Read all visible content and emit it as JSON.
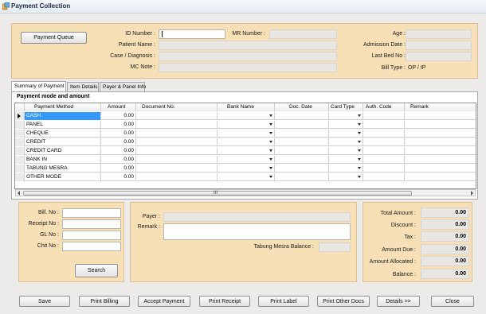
{
  "window": {
    "title": "Payment Collection",
    "icon": "app-icon"
  },
  "header": {
    "payment_queue_label": "Payment Queue",
    "id_number_label": "ID Number :",
    "id_number_value": "",
    "mr_number_label": "MR Number :",
    "mr_number_value": "",
    "age_label": "Age :",
    "age_value": "",
    "patient_name_label": "Patient Name :",
    "patient_name_value": "",
    "admission_date_label": "Admission Date :",
    "admission_date_value": "",
    "case_label": "Case / Diagnosis :",
    "case_value": "",
    "last_bed_label": "Last Bed No :",
    "last_bed_value": "",
    "mc_note_label": "MC Note :",
    "mc_note_value": "",
    "bill_type_label": "Bill Type :",
    "bill_type_value": "OP / IP"
  },
  "tabs": [
    {
      "label": "Summary of Payment",
      "active": true
    },
    {
      "label": "Item Details",
      "active": false
    },
    {
      "label": "Payer & Panel Info",
      "active": false
    }
  ],
  "payment_panel": {
    "title": "Payment mode and amount",
    "columns": [
      "Payment Method",
      "Amount",
      "Document No.",
      "Bank Name",
      "Doc. Date",
      "Card Type",
      "Auth. Code",
      "Remark"
    ],
    "rows": [
      {
        "method": "CASH",
        "amount": "0.00",
        "selected": true
      },
      {
        "method": "PANEL",
        "amount": "0.00"
      },
      {
        "method": "CHEQUE",
        "amount": "0.00"
      },
      {
        "method": "CREDIT",
        "amount": "0.00"
      },
      {
        "method": "CREDIT CARD",
        "amount": "0.00"
      },
      {
        "method": "BANK IN",
        "amount": "0.00"
      },
      {
        "method": "TABUNG MESRA",
        "amount": "0.00"
      },
      {
        "method": "OTHER MODE",
        "amount": "0.00"
      }
    ],
    "scroll_grip": "III"
  },
  "search_box": {
    "bill_no_label": "Bill. No :",
    "receipt_no_label": "Receipt No :",
    "gl_no_label": "GL No :",
    "chit_no_label": "Chit No :",
    "search_label": "Search"
  },
  "payer_box": {
    "payer_label": "Payer :",
    "payer_value": "",
    "remark_label": "Remark :",
    "remark_value": "",
    "tabung_label": "Tabung Mesra Balance :",
    "tabung_value": ""
  },
  "totals": {
    "total_amount_label": "Total Amount :",
    "total_amount": "0.00",
    "discount_label": "Discount :",
    "discount": "0.00",
    "tax_label": "Tax :",
    "tax": "0.00",
    "amount_due_label": "Amount Due :",
    "amount_due": "0.00",
    "amount_allocated_label": "Amount Allocated :",
    "amount_allocated": "0.00",
    "balance_label": "Balance :",
    "balance": "0.00"
  },
  "footer": {
    "save": "Save",
    "print_billing": "Print Billing",
    "accept_payment": "Accept Payment",
    "print_receipt": "Print Receipt",
    "print_label": "Print Label",
    "print_other_docs": "Print Other Docs",
    "details": "Details >>",
    "close": "Close"
  }
}
